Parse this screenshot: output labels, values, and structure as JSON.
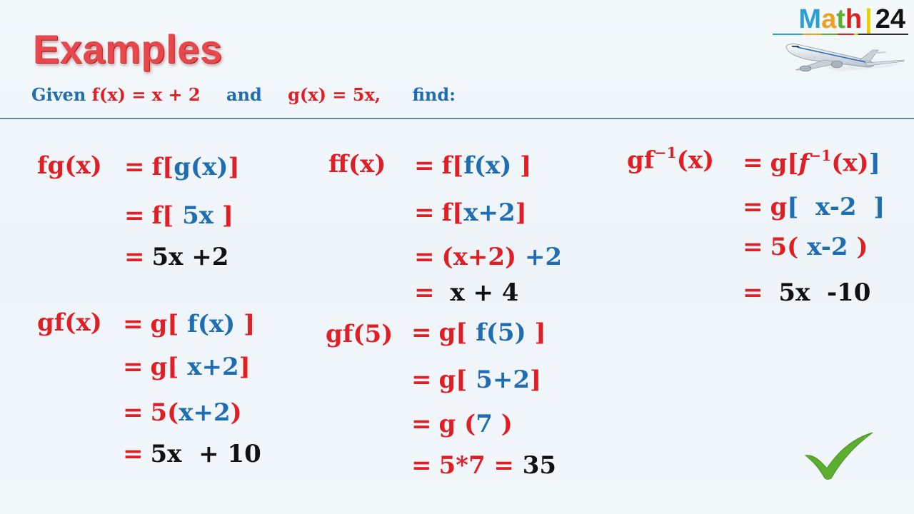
{
  "header": {
    "title": "Examples",
    "given": {
      "prefix": "Given ",
      "f_def": "f(x) = x + 2",
      "and": "and",
      "g_def": "g(x) = 5x,",
      "suffix": "find:"
    }
  },
  "logo": {
    "letters": [
      "M",
      "a",
      "t",
      "h"
    ],
    "separator": "|",
    "number": "24",
    "icon": "airplane-icon"
  },
  "colors": {
    "title_red": "#e8474b",
    "text_red": "#e01e24",
    "text_blue": "#1f6db3",
    "text_black": "#111111",
    "divider": "#5f8aa5",
    "check_green": "#5cae2e"
  },
  "examples": {
    "fg": {
      "lhs": "fg(x)",
      "steps": [
        {
          "eq": "=",
          "parts": [
            {
              "t": "f[",
              "c": "red"
            },
            {
              "t": "g(x)",
              "c": "blue"
            },
            {
              "t": "]",
              "c": "red"
            }
          ]
        },
        {
          "eq": "=",
          "parts": [
            {
              "t": "f[ ",
              "c": "red"
            },
            {
              "t": "5x",
              "c": "blue"
            },
            {
              "t": " ]",
              "c": "red"
            }
          ]
        },
        {
          "eq": "=",
          "parts": [
            {
              "t": "5x +2",
              "c": "black"
            }
          ]
        }
      ]
    },
    "gf": {
      "lhs": "gf(x)",
      "steps": [
        {
          "eq": "=",
          "parts": [
            {
              "t": "g[ ",
              "c": "red"
            },
            {
              "t": "f(x)",
              "c": "blue"
            },
            {
              "t": " ]",
              "c": "red"
            }
          ]
        },
        {
          "eq": "=",
          "parts": [
            {
              "t": "g[ ",
              "c": "red"
            },
            {
              "t": "x+2",
              "c": "blue"
            },
            {
              "t": "]",
              "c": "red"
            }
          ]
        },
        {
          "eq": "=",
          "parts": [
            {
              "t": "5(",
              "c": "red"
            },
            {
              "t": "x+2",
              "c": "blue"
            },
            {
              "t": ")",
              "c": "red"
            }
          ]
        },
        {
          "eq": "=",
          "parts": [
            {
              "t": "5x  + 10",
              "c": "black"
            }
          ]
        }
      ]
    },
    "ff": {
      "lhs": "ff(x)",
      "steps": [
        {
          "eq": "=",
          "parts": [
            {
              "t": "f[",
              "c": "red"
            },
            {
              "t": "f(x) ",
              "c": "blue"
            },
            {
              "t": "]",
              "c": "red"
            }
          ]
        },
        {
          "eq": "=",
          "parts": [
            {
              "t": "f[",
              "c": "red"
            },
            {
              "t": "x+2",
              "c": "blue"
            },
            {
              "t": "]",
              "c": "red"
            }
          ]
        },
        {
          "eq": "=",
          "parts": [
            {
              "t": "(x+2)",
              "c": "red"
            },
            {
              "t": " +2",
              "c": "blue"
            }
          ]
        },
        {
          "eq": "=",
          "parts": [
            {
              "t": " x + 4",
              "c": "black"
            }
          ]
        }
      ]
    },
    "gf5": {
      "lhs": "gf(5)",
      "steps": [
        {
          "eq": "=",
          "parts": [
            {
              "t": "g[ ",
              "c": "red"
            },
            {
              "t": "f(5)",
              "c": "blue"
            },
            {
              "t": " ]",
              "c": "red"
            }
          ]
        },
        {
          "eq": "=",
          "parts": [
            {
              "t": "g[ ",
              "c": "red"
            },
            {
              "t": "5+2",
              "c": "blue"
            },
            {
              "t": "]",
              "c": "red"
            }
          ]
        },
        {
          "eq": "=",
          "parts": [
            {
              "t": "g (",
              "c": "red"
            },
            {
              "t": "7",
              "c": "blue"
            },
            {
              "t": " )",
              "c": "red"
            }
          ]
        },
        {
          "eq": "=",
          "parts": [
            {
              "t": "5*7 = ",
              "c": "red"
            },
            {
              "t": "35",
              "c": "black"
            }
          ]
        }
      ]
    },
    "gfinv": {
      "lhs_base": "gf",
      "lhs_sup": "−1",
      "lhs_arg": "(x)",
      "steps": [
        {
          "eq": "=",
          "parts": [
            {
              "t": "g[",
              "c": "red"
            },
            {
              "t": "f",
              "c": "red",
              "i": true
            },
            {
              "t": "−1",
              "c": "red",
              "sup": true
            },
            {
              "t": "(x)",
              "c": "red"
            },
            {
              "t": "]",
              "c": "blue"
            }
          ]
        },
        {
          "eq": "=",
          "parts": [
            {
              "t": "g",
              "c": "red"
            },
            {
              "t": "[  x-2  ]",
              "c": "blue"
            }
          ]
        },
        {
          "eq": "=",
          "parts": [
            {
              "t": "5(",
              "c": "red"
            },
            {
              "t": " x-2 ",
              "c": "blue"
            },
            {
              "t": ")",
              "c": "red"
            }
          ]
        },
        {
          "eq": "=",
          "parts": [
            {
              "t": " 5x  -10",
              "c": "black"
            }
          ]
        }
      ]
    }
  },
  "checkmark": {
    "icon": "checkmark-icon"
  }
}
